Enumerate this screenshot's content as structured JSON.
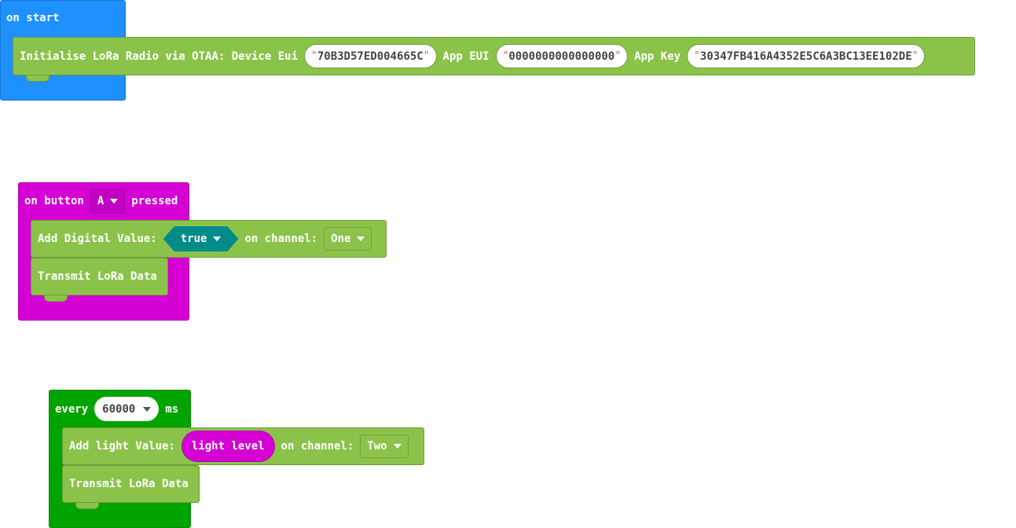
{
  "on_start": {
    "label": "on start",
    "block": {
      "label": "Initialise LoRa Radio via OTAA: Device Eui",
      "device_eui": "70B3D57ED004665C",
      "app_eui_label": "App EUI",
      "app_eui": "0000000000000000",
      "app_key_label": "App Key",
      "app_key": "30347FB416A4352E5C6A3BC13EE102DE"
    }
  },
  "on_button": {
    "label_prefix": "on button",
    "button": "A",
    "label_suffix": "pressed",
    "add_block": {
      "label": "Add Digital Value:",
      "value": "true",
      "channel_label": "on channel:",
      "channel": "One"
    },
    "transmit_label": "Transmit LoRa Data"
  },
  "every": {
    "label_prefix": "every",
    "interval": "60000",
    "label_suffix": "ms",
    "add_block": {
      "label": "Add light Value:",
      "value": "light level",
      "channel_label": "on channel:",
      "channel": "Two"
    },
    "transmit_label": "Transmit LoRa Data"
  },
  "quote": "\"",
  "colors": {
    "on_start": "#1e90ff",
    "on_button": "#d400d4",
    "every": "#00a400",
    "lora_block": "#8bc34a",
    "boolean": "#008b8b",
    "light": "#d400d4"
  }
}
